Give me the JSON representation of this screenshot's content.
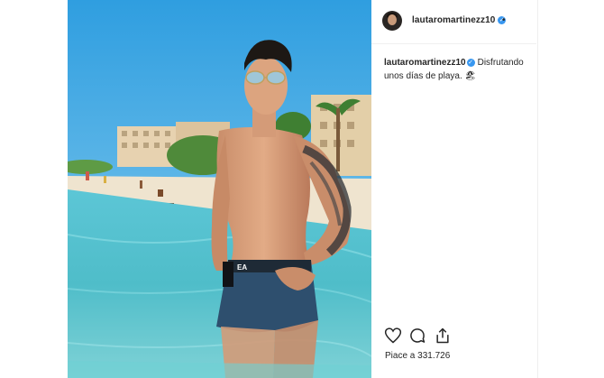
{
  "post": {
    "username": "lautaromartinezz10",
    "verified_glyph": "✓",
    "separator": "•",
    "caption": {
      "username": "lautaromartinezz10",
      "text": "Disfrutando unos días de playa. 🏖"
    },
    "likes_text": "Piace a 331.726"
  },
  "icons": {
    "like": "heart-icon",
    "comment": "comment-icon",
    "share": "share-icon"
  },
  "colors": {
    "verified": "#3897f0",
    "text": "#262626",
    "divider": "#efefef"
  }
}
